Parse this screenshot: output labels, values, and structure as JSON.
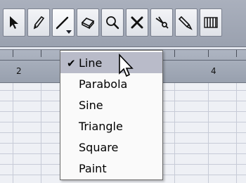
{
  "toolbar": {
    "tools": [
      {
        "name": "arrow-tool",
        "icon": "arrow-icon"
      },
      {
        "name": "pencil-tool",
        "icon": "pencil-icon"
      },
      {
        "name": "line-tool",
        "icon": "line-icon",
        "active": true,
        "has_dropdown": true
      },
      {
        "name": "erase-tool",
        "icon": "eraser-icon"
      },
      {
        "name": "zoom-tool",
        "icon": "magnifier-icon"
      },
      {
        "name": "delete-tool",
        "icon": "x-icon"
      },
      {
        "name": "split-tool",
        "icon": "scissors-icon"
      },
      {
        "name": "glue-tool",
        "icon": "glue-icon"
      },
      {
        "name": "quantize-tool",
        "icon": "bars-icon"
      }
    ]
  },
  "ruler": {
    "labels": [
      "2",
      "4"
    ]
  },
  "menu": {
    "items": [
      {
        "label": "Line",
        "checked": true,
        "highlighted": true
      },
      {
        "label": "Parabola"
      },
      {
        "label": "Sine"
      },
      {
        "label": "Triangle"
      },
      {
        "label": "Square"
      },
      {
        "label": "Paint"
      }
    ]
  },
  "colors": {
    "toolbar_bg": "#a3aab7",
    "menu_bg": "#fafafa",
    "menu_highlight": "#b9bbc9",
    "grid_bg": "#eef0f5"
  }
}
